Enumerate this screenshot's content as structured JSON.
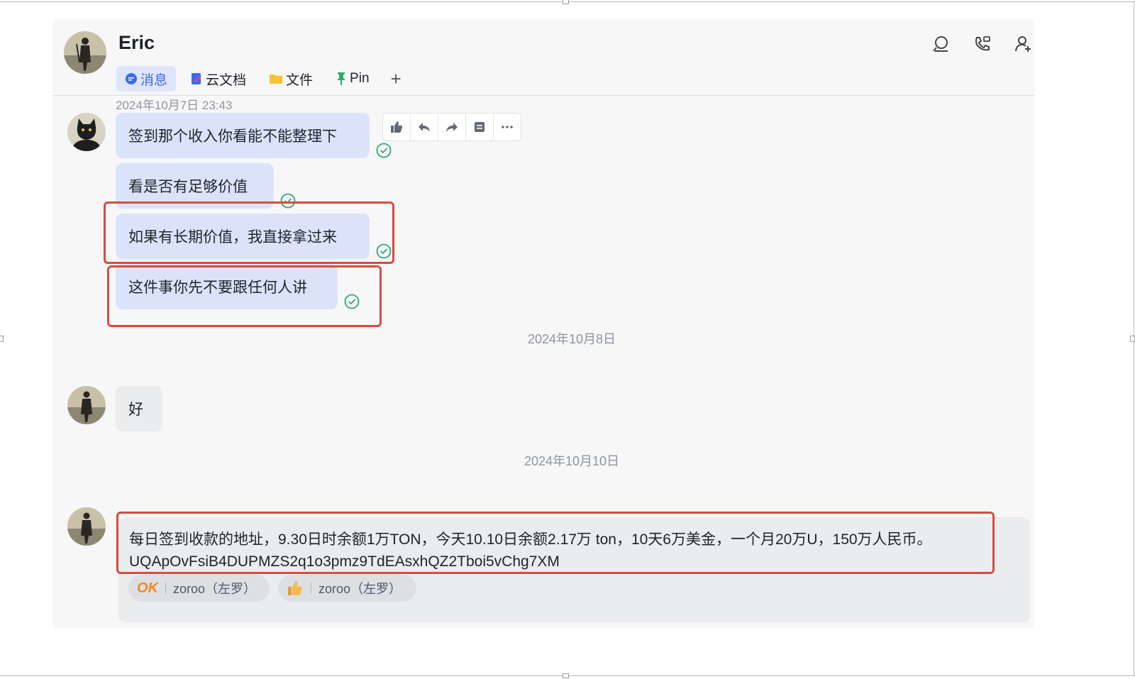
{
  "chat": {
    "name": "Eric",
    "tabs": [
      {
        "label": "消息",
        "icon": "message-icon"
      },
      {
        "label": "云文档",
        "icon": "doc-icon"
      },
      {
        "label": "文件",
        "icon": "folder-icon"
      },
      {
        "label": "Pin",
        "icon": "pin-icon"
      }
    ],
    "add_tab": "+",
    "header_icons": [
      "search-icon",
      "video-call-icon",
      "add-member-icon"
    ]
  },
  "messages": {
    "timestamp1": "2024年10月7日 23:43",
    "m1": "签到那个收入你看能不能整理下",
    "m2": "看是否有足够价值",
    "m3": "如果有长期价值，我直接拿过来",
    "m4": "这件事你先不要跟任何人讲",
    "date2": "2024年10月8日",
    "m5": "好",
    "date3": "2024年10月10日",
    "m6_line1": "每日签到收款的地址，9.30日时余额1万TON，今天10.10日余额2.17万 ton，10天6万美金，一个月20万U，150万人民币。",
    "m6_line2": "UQApOvFsiB4DUPMZS2q1o3pmz9TdEAsxhQZ2Tboi5vChg7XM"
  },
  "reactions": [
    {
      "emoji": "OK",
      "user": "zoroo（左罗）"
    },
    {
      "emoji": "thumbs-up",
      "user": "zoroo（左罗）"
    }
  ],
  "toolbar": [
    "thumbs-up-icon",
    "reply-icon",
    "forward-icon",
    "quote-icon",
    "more-icon"
  ],
  "colors": {
    "highlight": "#d94b3e",
    "accent": "#3b6af5",
    "bubble_self": "#dbe3fb",
    "read_check": "#2fa872"
  }
}
